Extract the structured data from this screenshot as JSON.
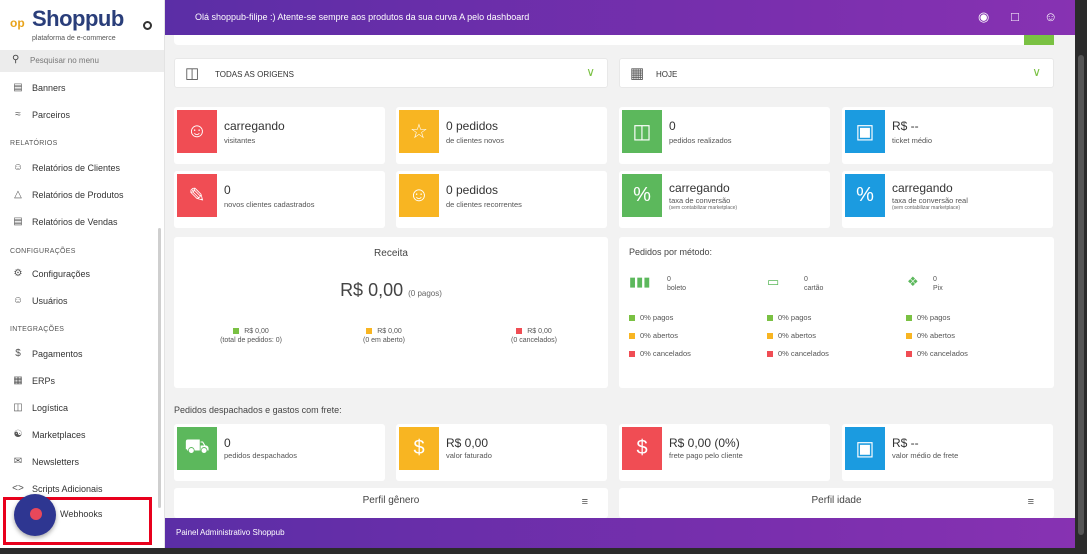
{
  "logo": {
    "name": "Shoppub",
    "mark": "op",
    "subtitle": "plataforma de e-commerce"
  },
  "search": {
    "placeholder": "Pesquisar no menu"
  },
  "sidebar": {
    "items_top": [
      {
        "label": "Banners",
        "icon": "image-icon"
      },
      {
        "label": "Parceiros",
        "icon": "partners-icon"
      }
    ],
    "sections": [
      {
        "title": "RELATÓRIOS",
        "items": [
          {
            "label": "Relatórios de Clientes",
            "icon": "people-icon"
          },
          {
            "label": "Relatórios de Produtos",
            "icon": "box-icon"
          },
          {
            "label": "Relatórios de Vendas",
            "icon": "list-icon"
          }
        ]
      },
      {
        "title": "CONFIGURAÇÕES",
        "items": [
          {
            "label": "Configurações",
            "icon": "gear-icon"
          },
          {
            "label": "Usuários",
            "icon": "user-icon"
          }
        ]
      },
      {
        "title": "INTEGRAÇÕES",
        "items": [
          {
            "label": "Pagamentos",
            "icon": "dollar-icon"
          },
          {
            "label": "ERPs",
            "icon": "erp-icon"
          },
          {
            "label": "Logística",
            "icon": "truck-icon"
          },
          {
            "label": "Marketplaces",
            "icon": "marketplace-icon"
          },
          {
            "label": "Newsletters",
            "icon": "mail-icon"
          },
          {
            "label": "Scripts Adicionais",
            "icon": "code-icon"
          }
        ]
      }
    ],
    "webhooks": "Webhooks"
  },
  "topbar": {
    "message": "Olá shoppub-filipe :) Atente-se sempre aos produtos da sua curva A pelo dashboard"
  },
  "filters": {
    "origin": "TODAS AS ORIGENS",
    "period": "HOJE"
  },
  "cards_row1": [
    {
      "big": "carregando",
      "small": "visitantes",
      "color": "#f04d54",
      "icon": "visitors-icon"
    },
    {
      "big": "0 pedidos",
      "small": "de clientes novos",
      "color": "#f8b522",
      "icon": "new-customer-icon"
    },
    {
      "big": "0",
      "small": "pedidos realizados",
      "color": "#5cb85c",
      "icon": "cart-icon"
    },
    {
      "big": "R$ --",
      "small": "ticket médio",
      "color": "#1b9be0",
      "icon": "ticket-icon"
    }
  ],
  "cards_row2": [
    {
      "big": "0",
      "small": "novos clientes cadastrados",
      "tiny": "",
      "color": "#f04d54",
      "icon": "register-icon"
    },
    {
      "big": "0 pedidos",
      "small": "de clientes recorrentes",
      "tiny": "",
      "color": "#f8b522",
      "icon": "recurring-icon"
    },
    {
      "big": "carregando",
      "small": "taxa de conversão",
      "tiny": "(sem contabilizar marketplace)",
      "color": "#5cb85c",
      "icon": "conversion-icon"
    },
    {
      "big": "carregando",
      "small": "taxa de conversão real",
      "tiny": "(sem contabilizar marketplace)",
      "color": "#1b9be0",
      "icon": "conversion-real-icon"
    }
  ],
  "revenue": {
    "title": "Receita",
    "total": "R$ 0,00",
    "total_note": "(0 pagos)",
    "legend": [
      {
        "value": "R$ 0,00",
        "note": "(total de pedidos: 0)",
        "color": "#7ac143"
      },
      {
        "value": "R$ 0,00",
        "note": "(0 em aberto)",
        "color": "#f8b522"
      },
      {
        "value": "R$ 0,00",
        "note": "(0 cancelados)",
        "color": "#f04d54"
      }
    ]
  },
  "payment_methods": {
    "title": "Pedidos por método:",
    "methods": [
      {
        "count": "0",
        "name": "boleto",
        "icon": "barcode-icon"
      },
      {
        "count": "0",
        "name": "cartão",
        "icon": "card-icon"
      },
      {
        "count": "0",
        "name": "Pix",
        "icon": "pix-icon"
      }
    ],
    "status_rows": [
      "0% pagos",
      "0% abertos",
      "0% cancelados"
    ],
    "status_colors": [
      "#7ac143",
      "#f8b522",
      "#f04d54"
    ]
  },
  "shipping": {
    "title": "Pedidos despachados e gastos com frete:"
  },
  "cards_row3": [
    {
      "big": "0",
      "small": "pedidos despachados",
      "color": "#5cb85c",
      "icon": "delivery-icon"
    },
    {
      "big": "R$ 0,00",
      "small": "valor faturado",
      "color": "#f8b522",
      "icon": "invoice-truck-icon"
    },
    {
      "big": "R$ 0,00 (0%)",
      "small": "frete pago pelo cliente",
      "color": "#f04d54",
      "icon": "customer-freight-icon"
    },
    {
      "big": "R$ --",
      "small": "valor médio de frete",
      "color": "#1b9be0",
      "icon": "avg-freight-icon"
    }
  ],
  "profiles": {
    "gender": "Perfil gênero",
    "age": "Perfil idade"
  },
  "footer": {
    "text": "Painel Administrativo Shoppub"
  }
}
